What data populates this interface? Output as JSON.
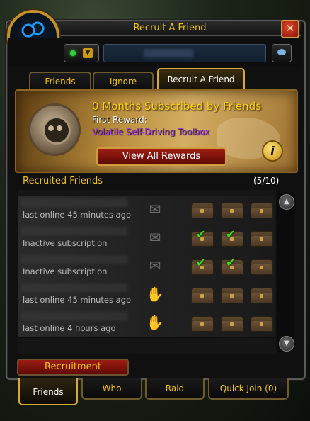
{
  "window": {
    "title": "Recruit A Friend",
    "close_label": "✕"
  },
  "toolbar": {
    "status_arrow": "▼"
  },
  "subtabs": [
    {
      "label": "Friends"
    },
    {
      "label": "Ignore"
    },
    {
      "label": "Recruit A Friend",
      "active": true
    }
  ],
  "banner": {
    "title": "0 Months Subscribed by Friends",
    "reward_label": "First Reward:",
    "reward_item": "Volatile Self-Driving Toolbox",
    "view_rewards_label": "View All Rewards",
    "info_label": "i"
  },
  "recruited": {
    "header": "Recruited Friends",
    "count": "(5/10)",
    "rows": [
      {
        "status": "last online 45 minutes ago",
        "icon": "scroll",
        "checks": [
          false,
          false,
          false
        ]
      },
      {
        "status": "Inactive subscription",
        "icon": "scroll",
        "checks": [
          true,
          true,
          false
        ]
      },
      {
        "status": "Inactive subscription",
        "icon": "scroll",
        "checks": [
          true,
          true,
          false
        ]
      },
      {
        "status": "last online 45 minutes ago",
        "icon": "handshake",
        "checks": [
          false,
          false,
          false
        ]
      },
      {
        "status": "last online 4 hours ago",
        "icon": "handshake",
        "checks": [
          false,
          false,
          false
        ]
      }
    ]
  },
  "recruitment_button": "Recruitment",
  "bottom_tabs": [
    {
      "label": "Friends",
      "active": true
    },
    {
      "label": "Who"
    },
    {
      "label": "Raid"
    },
    {
      "label": "Quick Join (0)"
    }
  ],
  "colors": {
    "gold": "#f0c419",
    "epic": "#a335ee",
    "online": "#2fd13a",
    "check": "#38e01e"
  }
}
